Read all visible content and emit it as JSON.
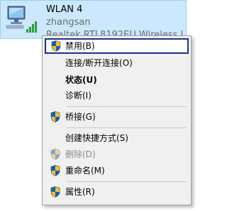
{
  "adapter": {
    "name": "WLAN 4",
    "ssid": "zhangsan",
    "device": "Realtek RTL8192EU Wireless L",
    "icon": "wireless-adapter-icon",
    "selection_color": "#cce8ff"
  },
  "menu": {
    "items": [
      {
        "label": "禁用(B)",
        "icon": "uac-shield-icon",
        "highlighted": true
      },
      {
        "label": "连接/断开连接(O)"
      },
      {
        "label": "状态(U)",
        "bold": true
      },
      {
        "label": "诊断(I)"
      },
      {
        "label": "桥接(G)",
        "icon": "uac-shield-icon"
      },
      {
        "label": "创建快捷方式(S)"
      },
      {
        "label": "删除(D)",
        "icon": "uac-shield-icon",
        "disabled": true
      },
      {
        "label": "重命名(M)",
        "icon": "uac-shield-icon"
      },
      {
        "label": "属性(R)",
        "icon": "uac-shield-icon"
      }
    ]
  }
}
